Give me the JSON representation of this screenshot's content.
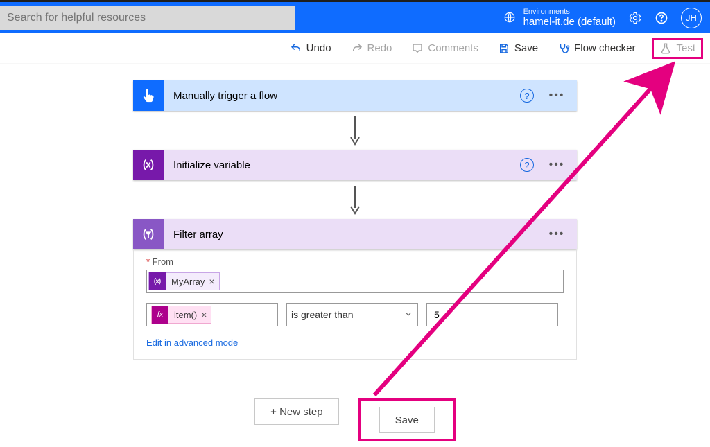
{
  "header": {
    "search_placeholder": "Search for helpful resources",
    "env_label": "Environments",
    "env_name": "hamel-it.de (default)",
    "user_initials": "JH"
  },
  "toolbar": {
    "undo": "Undo",
    "redo": "Redo",
    "comments": "Comments",
    "save": "Save",
    "flow_checker": "Flow checker",
    "test": "Test"
  },
  "flow": {
    "trigger_title": "Manually trigger a flow",
    "init_title": "Initialize variable",
    "filter_title": "Filter array",
    "filter": {
      "from_label": "From",
      "from_token": "MyArray",
      "cond_left_token": "item()",
      "cond_op": "is greater than",
      "cond_value": "5",
      "adv_link": "Edit in advanced mode"
    }
  },
  "footer": {
    "new_step": "+ New step",
    "save": "Save"
  }
}
